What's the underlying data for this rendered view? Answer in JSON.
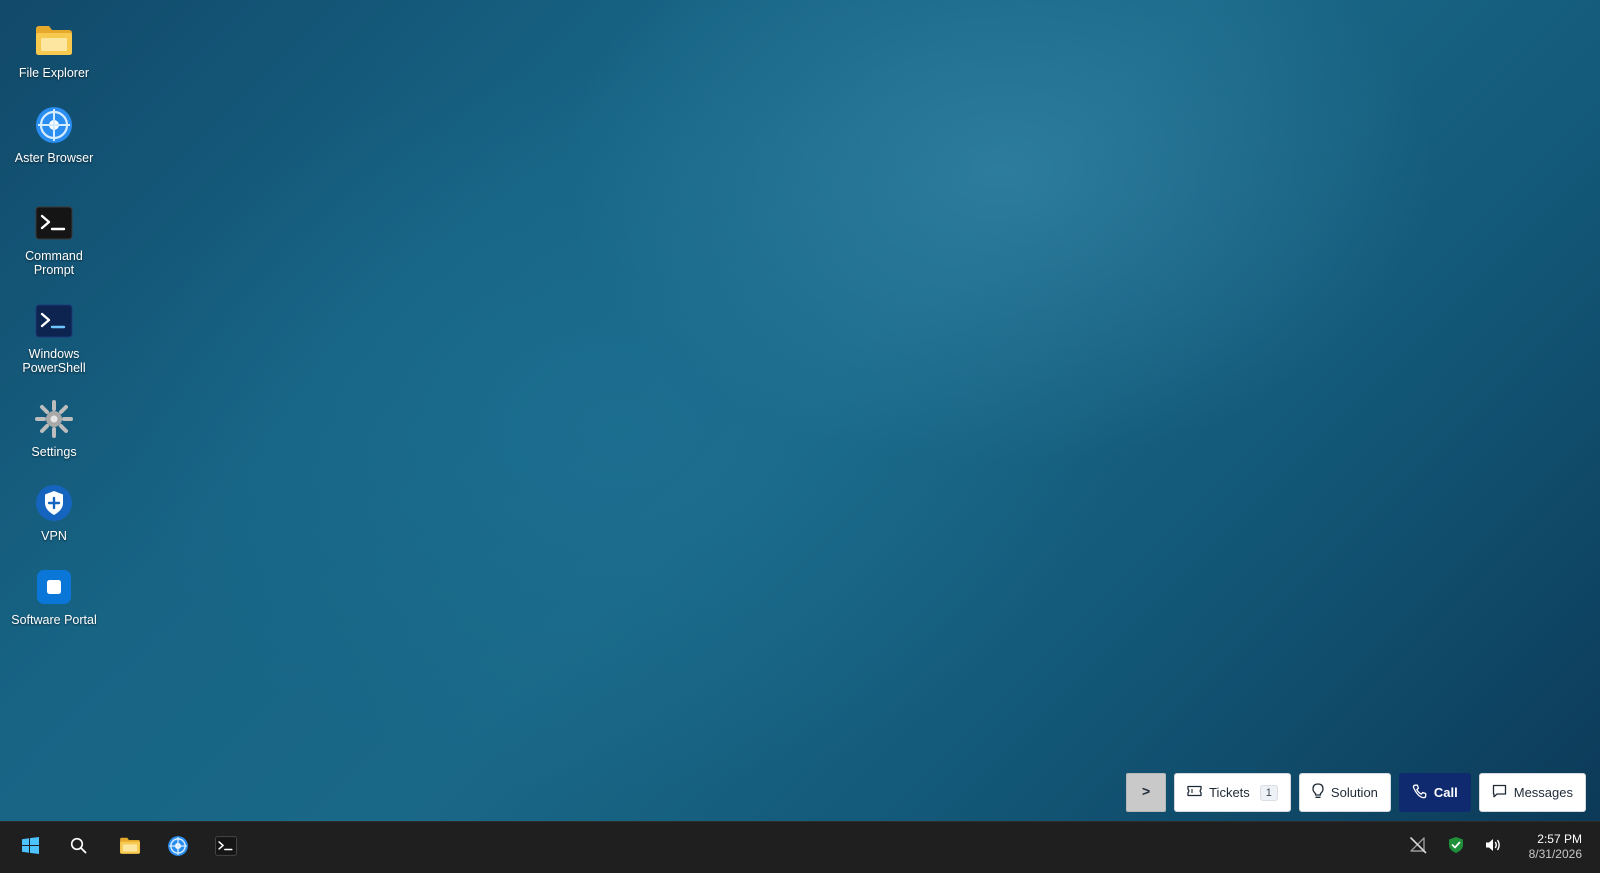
{
  "desktop": {
    "icons": [
      {
        "label": "File Explorer",
        "icon": "folder-icon"
      },
      {
        "label": "Aster Browser",
        "icon": "browser-icon"
      },
      {
        "label": "Command Prompt",
        "icon": "terminal-icon"
      },
      {
        "label": "Windows PowerShell",
        "icon": "powershell-icon"
      },
      {
        "label": "Settings",
        "icon": "gear-icon"
      },
      {
        "label": "VPN",
        "icon": "shield-icon"
      },
      {
        "label": "Software Portal",
        "icon": "portal-icon"
      }
    ]
  },
  "support_bar": {
    "toggle_label": ">",
    "tickets_label": "Tickets",
    "tickets_count": "1",
    "solution_label": "Solution",
    "call_label": "Call",
    "messages_label": "Messages"
  },
  "taskbar": {
    "pinned": [
      {
        "name": "start-button",
        "icon": "windows-logo-icon"
      },
      {
        "name": "search-button",
        "icon": "search-icon"
      },
      {
        "name": "file-explorer",
        "icon": "folder-icon"
      },
      {
        "name": "aster-browser",
        "icon": "browser-icon"
      },
      {
        "name": "command-prompt",
        "icon": "terminal-icon"
      }
    ],
    "tray": [
      {
        "name": "network",
        "icon": "network-disconnected-icon"
      },
      {
        "name": "security",
        "icon": "security-shield-icon"
      },
      {
        "name": "volume",
        "icon": "volume-icon"
      }
    ],
    "clock": {
      "time": "2:57 PM",
      "date": "8/31/2026"
    }
  },
  "colors": {
    "taskbar_bg": "#1f1f1f",
    "call_button_bg": "#0f2a6e",
    "folder_yellow": "#f5c24a",
    "browser_blue": "#2a8ef0",
    "vpn_blue": "#1565c0",
    "portal_blue": "#0a76d8"
  }
}
